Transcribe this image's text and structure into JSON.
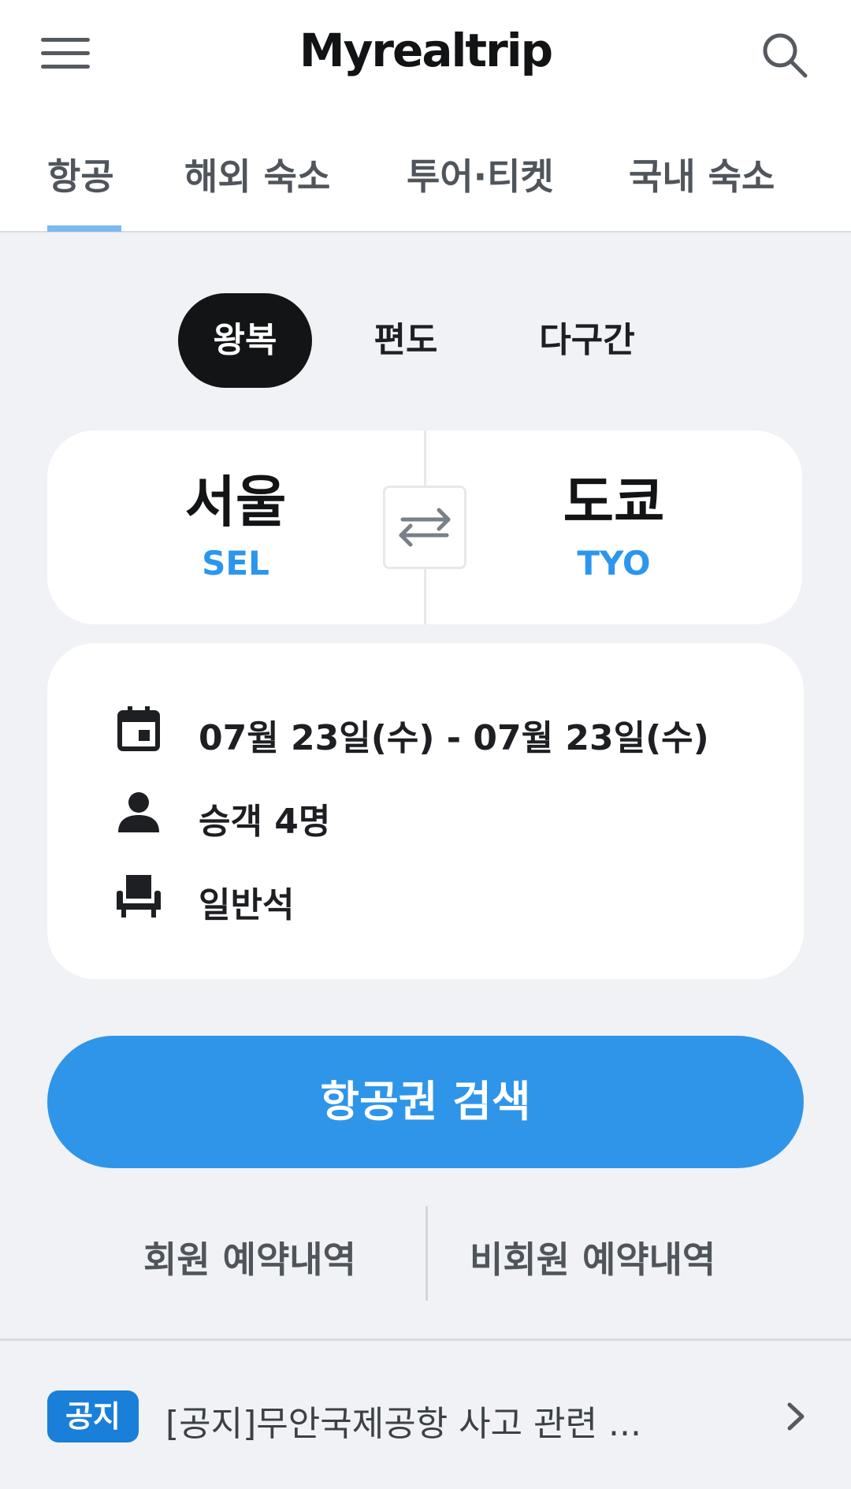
{
  "header": {
    "logo": "Myrealtrip",
    "menu_icon": "hamburger-menu-icon",
    "search_icon": "search-icon"
  },
  "nav_tabs": [
    {
      "label": "항공",
      "active": true
    },
    {
      "label": "해외 숙소",
      "active": false
    },
    {
      "label": "투어·티켓",
      "active": false
    },
    {
      "label": "국내 숙소",
      "active": false
    }
  ],
  "trip_types": [
    {
      "label": "왕복",
      "active": true
    },
    {
      "label": "편도",
      "active": false
    },
    {
      "label": "다구간",
      "active": false
    }
  ],
  "route": {
    "origin": {
      "name": "서울",
      "code": "SEL"
    },
    "destination": {
      "name": "도쿄",
      "code": "TYO"
    },
    "swap_icon": "swap-arrows-icon"
  },
  "details": {
    "dates": "07월 23일(수) - 07월 23일(수)",
    "passengers": "승객 4명",
    "seat_class": "일반석"
  },
  "search_button": "항공권 검색",
  "reservations": {
    "member": "회원 예약내역",
    "non_member": "비회원 예약내역"
  },
  "notice": {
    "badge": "공지",
    "text": "[공지]무안국제공항 사고 관련 ..."
  },
  "colors": {
    "accent": "#2f95e9",
    "code_blue": "#2b96ed",
    "background": "#f0f2f5",
    "active_pill": "#121416",
    "notice_badge": "#1a7fd9"
  }
}
